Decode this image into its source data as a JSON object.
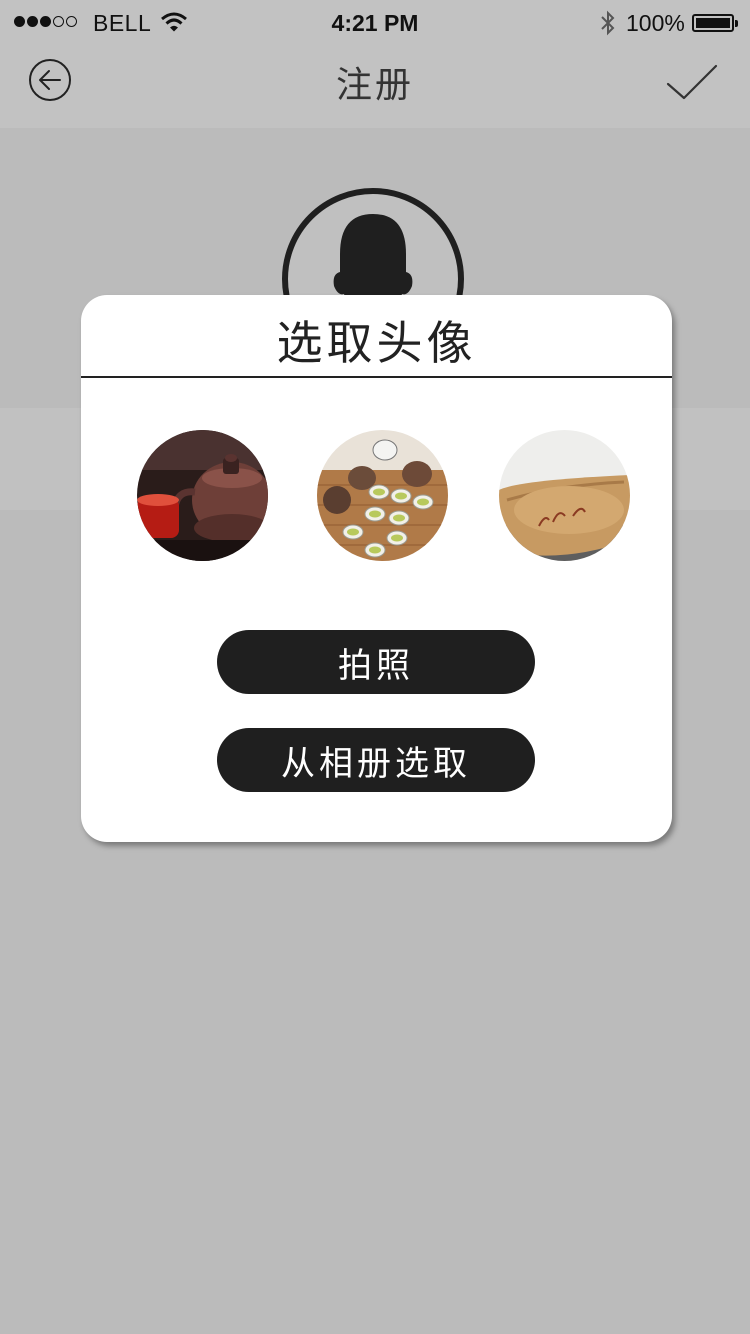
{
  "status_bar": {
    "carrier": "BELL",
    "time": "4:21 PM",
    "battery_percent": "100%",
    "signal_bars_filled": 3,
    "signal_bars_total": 5,
    "icons": [
      "signal-dots-icon",
      "wifi-icon",
      "bluetooth-icon",
      "battery-icon"
    ]
  },
  "nav": {
    "title": "注册",
    "back_icon": "back-arrow-circle-icon",
    "confirm_icon": "checkmark-icon"
  },
  "background": {
    "avatar_icon": "user-silhouette-icon"
  },
  "dialog": {
    "title": "选取头像",
    "preset_avatars": [
      {
        "name": "teapot-photo"
      },
      {
        "name": "tea-set-photo"
      },
      {
        "name": "clay-bowl-photo"
      }
    ],
    "buttons": {
      "take_photo": "拍照",
      "choose_from_album": "从相册选取"
    }
  },
  "colors": {
    "overlay_background": "#bbbbbb",
    "bar_background": "#c2c2c2",
    "dialog_background": "#ffffff",
    "button_background": "#1f1f1f",
    "button_text": "#ffffff"
  }
}
